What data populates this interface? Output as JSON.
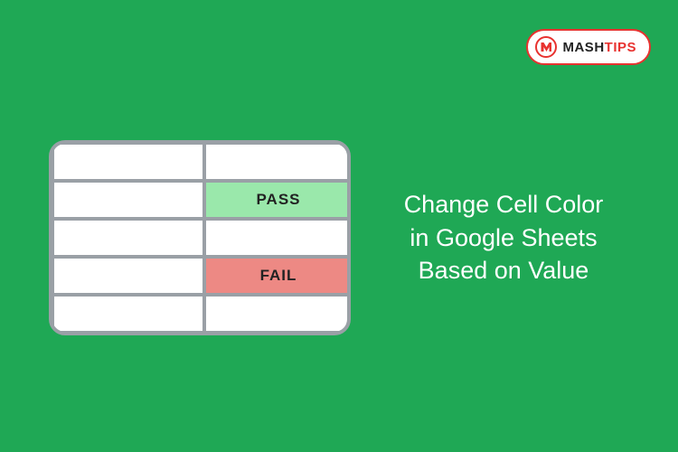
{
  "logo": {
    "brand_left": "MASH",
    "brand_right": "TIPS"
  },
  "table": {
    "rows": [
      {
        "left": "",
        "right": "",
        "right_style": ""
      },
      {
        "left": "",
        "right": "PASS",
        "right_style": "pass"
      },
      {
        "left": "",
        "right": "",
        "right_style": ""
      },
      {
        "left": "",
        "right": "FAIL",
        "right_style": "fail"
      },
      {
        "left": "",
        "right": "",
        "right_style": ""
      }
    ]
  },
  "headline": {
    "line1": "Change Cell Color",
    "line2": "in Google Sheets",
    "line3": "Based on Value"
  },
  "colors": {
    "background": "#1fa855",
    "pass_cell": "#9ae8ab",
    "fail_cell": "#ed8984",
    "grid_border": "#9aa0a6"
  }
}
